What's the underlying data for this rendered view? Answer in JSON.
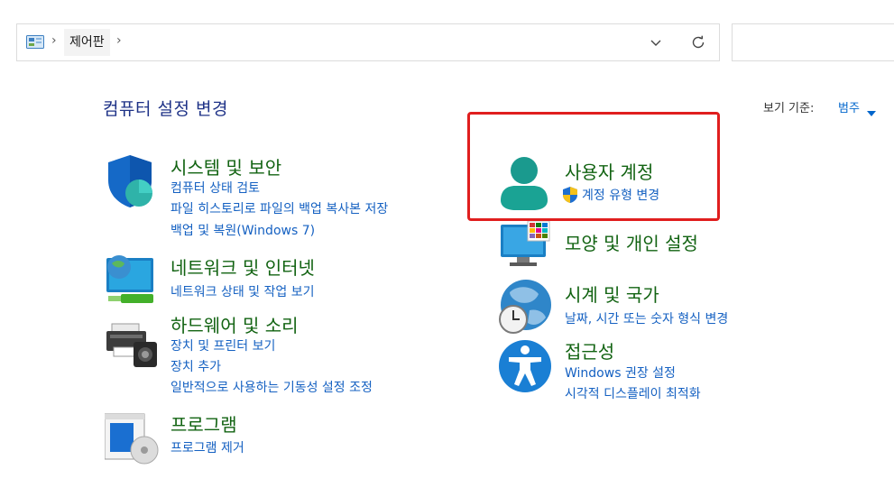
{
  "address_bar": {
    "crumb": "제어판",
    "icons": [
      "control-panel-icon",
      "chevron-right-icon",
      "chevron-down-icon",
      "refresh-icon"
    ]
  },
  "header": {
    "title": "컴퓨터 설정 변경",
    "view_by_label": "보기 기준:",
    "view_by_value": "범주"
  },
  "categories": [
    {
      "title": "시스템 및 보안",
      "icon": "shield-icon",
      "links": [
        "컴퓨터 상태 검토",
        "파일 히스토리로 파일의 백업 복사본 저장",
        "백업 및 복원(Windows 7)"
      ]
    },
    {
      "title": "네트워크 및 인터넷",
      "icon": "network-globe-icon",
      "links": [
        "네트워크 상태 및 작업 보기"
      ]
    },
    {
      "title": "하드웨어 및 소리",
      "icon": "printer-icon",
      "links": [
        "장치 및 프린터 보기",
        "장치 추가",
        "일반적으로 사용하는 기동성 설정 조정"
      ]
    },
    {
      "title": "프로그램",
      "icon": "programs-icon",
      "links": [
        "프로그램 제거"
      ]
    },
    {
      "title": "사용자 계정",
      "icon": "user-account-icon",
      "links": [
        "계정 유형 변경"
      ],
      "link_icon": "uac-shield-icon"
    },
    {
      "title": "모양 및 개인 설정",
      "icon": "monitor-personalize-icon",
      "links": []
    },
    {
      "title": "시계 및 국가",
      "icon": "clock-globe-icon",
      "links": [
        "날짜, 시간 또는 숫자 형식 변경"
      ]
    },
    {
      "title": "접근성",
      "icon": "accessibility-icon",
      "links": [
        "Windows 권장 설정",
        "시각적 디스플레이 최적화"
      ]
    }
  ],
  "colors": {
    "title_green": "#126312",
    "link_blue": "#1561c2",
    "header_blue": "#1e3287",
    "highlight_red": "#e01e1e"
  }
}
